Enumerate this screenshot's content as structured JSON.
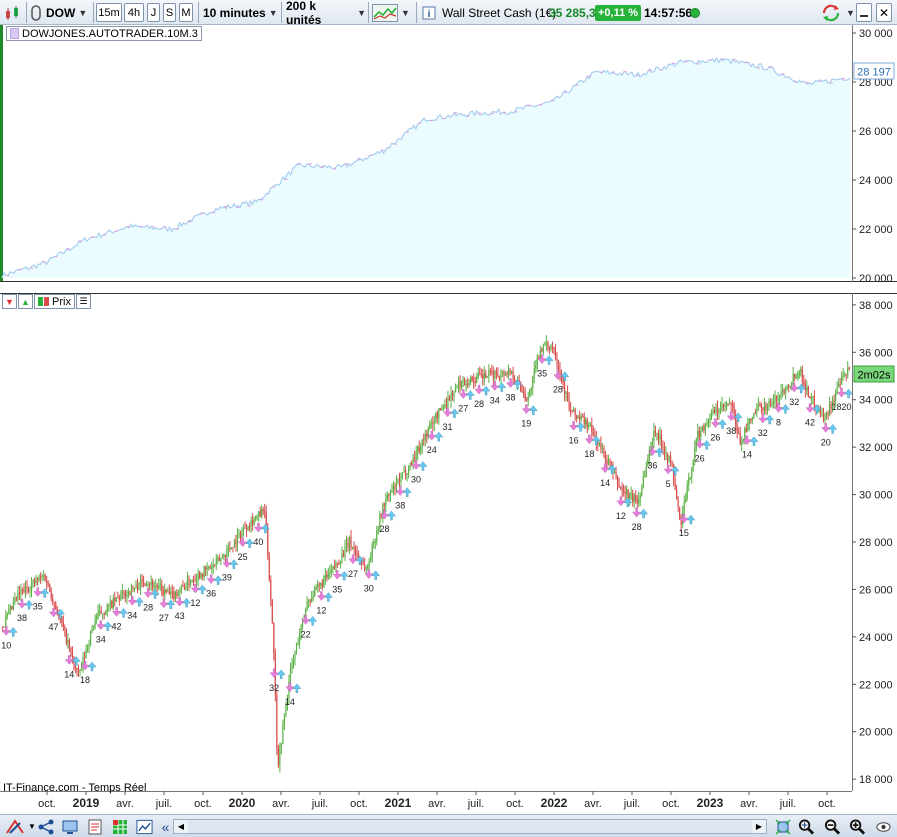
{
  "toolbar": {
    "symbol": "DOW",
    "timeframes": [
      "15m",
      "4h",
      "J",
      "S",
      "M"
    ],
    "interval": "10 minutes",
    "units": "200 k unités",
    "instrument": "Wall Street Cash (1€)",
    "price": "35 285,3",
    "change": "+0,11 %",
    "time": "14:57:56"
  },
  "indicator_panel": {
    "label": "DOWJONES.AUTOTRADER.10M.3",
    "value_tag": "28 197"
  },
  "price_panel": {
    "prix_label": "Prix",
    "time_tag": "2m02s",
    "source": "IT-Finance.com - Temps Réel"
  },
  "colors": {
    "accent_green": "#27b33b",
    "candle_up": "#5db248",
    "candle_down": "#d84c4c",
    "equity_line": "#a8cdf0",
    "equity_fill": "#eafcfd",
    "arrow_buy": "#66c8ee",
    "arrow_sell": "#e87ed9"
  },
  "chart_data": [
    {
      "type": "area",
      "name_in_image": "DOWJONES.AUTOTRADER.10M.3",
      "y_ticks": [
        "30 000",
        "28 000",
        "26 000",
        "24 000",
        "22 000",
        "20 000"
      ],
      "ylim": [
        20000,
        30000
      ],
      "x": [
        0,
        0.05,
        0.1,
        0.15,
        0.2,
        0.25,
        0.3,
        0.35,
        0.4,
        0.45,
        0.5,
        0.55,
        0.6,
        0.65,
        0.7,
        0.75,
        0.8,
        0.85,
        0.9,
        0.95,
        1.0
      ],
      "values": [
        20100,
        20600,
        21600,
        22100,
        22000,
        22800,
        23100,
        24600,
        24500,
        25200,
        26500,
        26700,
        26800,
        27200,
        28400,
        28300,
        28800,
        28900,
        28600,
        27900,
        28197
      ],
      "last_value": 28197
    },
    {
      "type": "candlestick",
      "y_ticks": [
        "38 000",
        "36 000",
        "34 000",
        "32 000",
        "30 000",
        "28 000",
        "26 000",
        "24 000",
        "22 000",
        "20 000",
        "18 000"
      ],
      "ylim": [
        17500,
        38500
      ],
      "x_ticks": [
        "oct.",
        "2019",
        "avr.",
        "juil.",
        "oct.",
        "2020",
        "avr.",
        "juil.",
        "oct.",
        "2021",
        "avr.",
        "juil.",
        "oct.",
        "2022",
        "avr.",
        "juil.",
        "oct.",
        "2023",
        "avr.",
        "juil.",
        "oct."
      ],
      "bold_ticks": [
        "2019",
        "2020",
        "2021",
        "2022",
        "2023"
      ],
      "price_path": [
        [
          0,
          24400
        ],
        [
          0.02,
          25800
        ],
        [
          0.05,
          26600
        ],
        [
          0.07,
          24600
        ],
        [
          0.09,
          22300
        ],
        [
          0.11,
          24800
        ],
        [
          0.14,
          25700
        ],
        [
          0.17,
          26400
        ],
        [
          0.2,
          25700
        ],
        [
          0.23,
          26600
        ],
        [
          0.25,
          27000
        ],
        [
          0.27,
          27800
        ],
        [
          0.29,
          28800
        ],
        [
          0.31,
          29300
        ],
        [
          0.32,
          24000
        ],
        [
          0.325,
          18500
        ],
        [
          0.34,
          22500
        ],
        [
          0.36,
          25500
        ],
        [
          0.39,
          26800
        ],
        [
          0.41,
          28000
        ],
        [
          0.43,
          26800
        ],
        [
          0.45,
          29600
        ],
        [
          0.48,
          31200
        ],
        [
          0.51,
          33200
        ],
        [
          0.54,
          34700
        ],
        [
          0.57,
          35000
        ],
        [
          0.6,
          35200
        ],
        [
          0.62,
          34000
        ],
        [
          0.635,
          36200
        ],
        [
          0.65,
          36300
        ],
        [
          0.67,
          33500
        ],
        [
          0.69,
          33000
        ],
        [
          0.71,
          31700
        ],
        [
          0.73,
          30200
        ],
        [
          0.75,
          29700
        ],
        [
          0.77,
          32800
        ],
        [
          0.79,
          31200
        ],
        [
          0.8,
          28700
        ],
        [
          0.82,
          32500
        ],
        [
          0.84,
          33500
        ],
        [
          0.86,
          33800
        ],
        [
          0.87,
          32200
        ],
        [
          0.89,
          33600
        ],
        [
          0.91,
          33900
        ],
        [
          0.93,
          34800
        ],
        [
          0.94,
          35300
        ],
        [
          0.95,
          34300
        ],
        [
          0.97,
          33200
        ],
        [
          0.99,
          34800
        ],
        [
          1.0,
          35285
        ]
      ],
      "signal_numbers": [
        "10",
        "38",
        "35",
        "47",
        "14",
        "18",
        "34",
        "42",
        "34",
        "28",
        "27",
        "43",
        "12",
        "36",
        "39",
        "25",
        "40",
        "32",
        "14",
        "22",
        "12",
        "35",
        "27",
        "30",
        "28",
        "38",
        "30",
        "24",
        "31",
        "27",
        "28",
        "34",
        "38",
        "19",
        "35",
        "28",
        "16",
        "18",
        "14",
        "12",
        "28",
        "36",
        "5",
        "15",
        "26",
        "26",
        "38",
        "14",
        "32",
        "8",
        "32",
        "42",
        "20",
        "1820"
      ]
    }
  ]
}
